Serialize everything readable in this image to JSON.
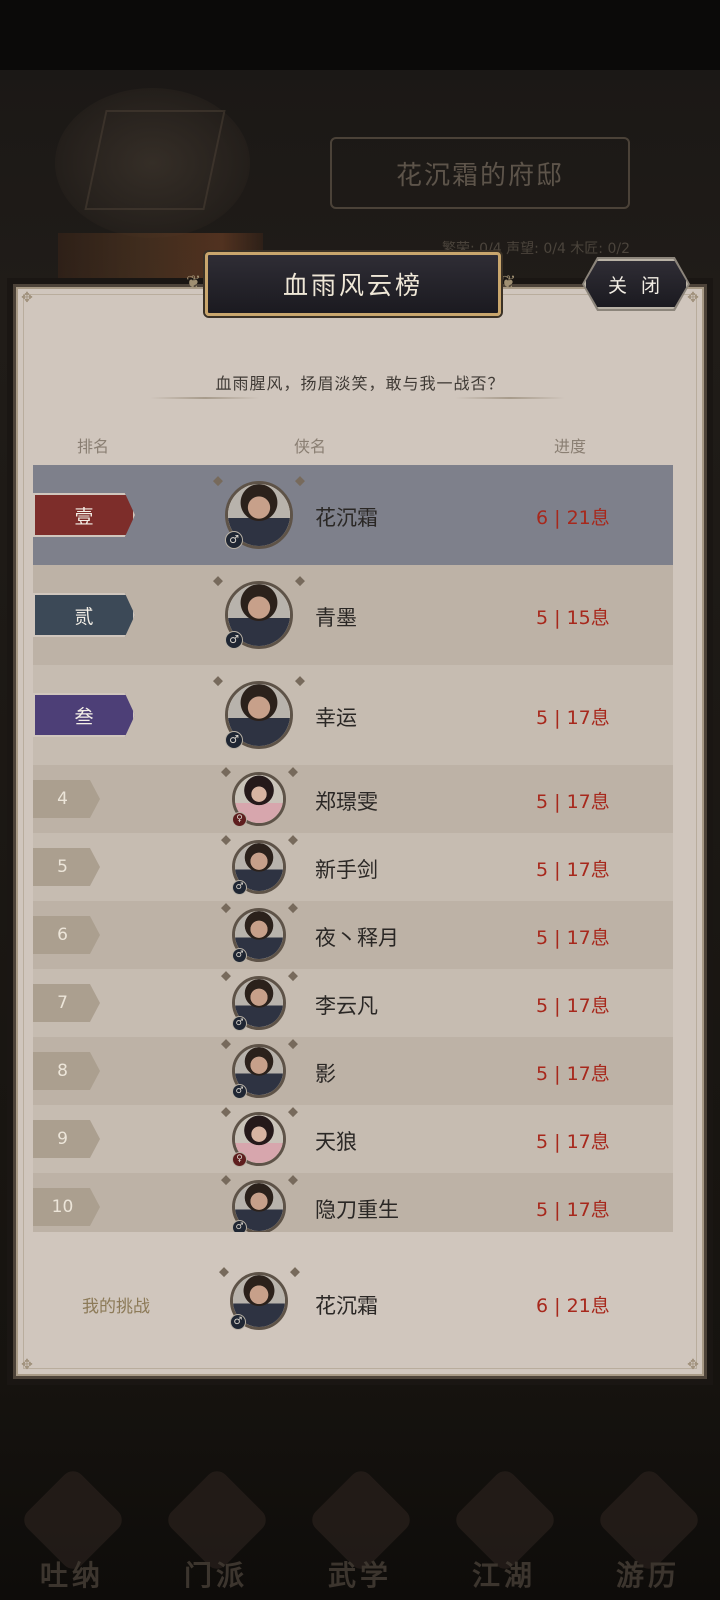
{
  "background": {
    "mansion_title": "花沉霜的府邸",
    "stat_text": "繁荣: 0/4    声望: 0/4   木匠: 0/2",
    "nav": [
      "吐纳",
      "门派",
      "武学",
      "江湖",
      "游历"
    ]
  },
  "modal": {
    "title": "血雨风云榜",
    "close_label": "关 闭",
    "subtitle": "血雨腥风，扬眉淡笑，敢与我一战否？",
    "headers": {
      "rank": "排名",
      "name": "侠名",
      "progress": "进度"
    }
  },
  "rows": [
    {
      "rank": "壹",
      "name": "花沉霜",
      "progress": "6 | 21息",
      "gender": "male",
      "rank_color": "#7d2d2a",
      "highlight": true
    },
    {
      "rank": "贰",
      "name": "青墨",
      "progress": "5 | 15息",
      "gender": "male",
      "rank_color": "#3c4957"
    },
    {
      "rank": "叁",
      "name": "幸运",
      "progress": "5 | 17息",
      "gender": "male",
      "rank_color": "#4d3f77"
    },
    {
      "rank": "4",
      "name": "郑璟雯",
      "progress": "5 | 17息",
      "gender": "female"
    },
    {
      "rank": "5",
      "name": "新手剑",
      "progress": "5 | 17息",
      "gender": "male"
    },
    {
      "rank": "6",
      "name": "夜丶释月",
      "progress": "5 | 17息",
      "gender": "male"
    },
    {
      "rank": "7",
      "name": "李云凡",
      "progress": "5 | 17息",
      "gender": "male"
    },
    {
      "rank": "8",
      "name": "影",
      "progress": "5 | 17息",
      "gender": "male"
    },
    {
      "rank": "9",
      "name": "天狼",
      "progress": "5 | 17息",
      "gender": "female"
    },
    {
      "rank": "10",
      "name": "隐刀重生",
      "progress": "5 | 17息",
      "gender": "male"
    }
  ],
  "my_challenge": {
    "label": "我的挑战",
    "name": "花沉霜",
    "progress": "6 | 21息",
    "gender": "male"
  },
  "colors": {
    "highlight_row": "#7e808b",
    "row_light": "#c6bcb1",
    "row_dark": "#bdb2a6",
    "progress_red": "#a7281c"
  }
}
